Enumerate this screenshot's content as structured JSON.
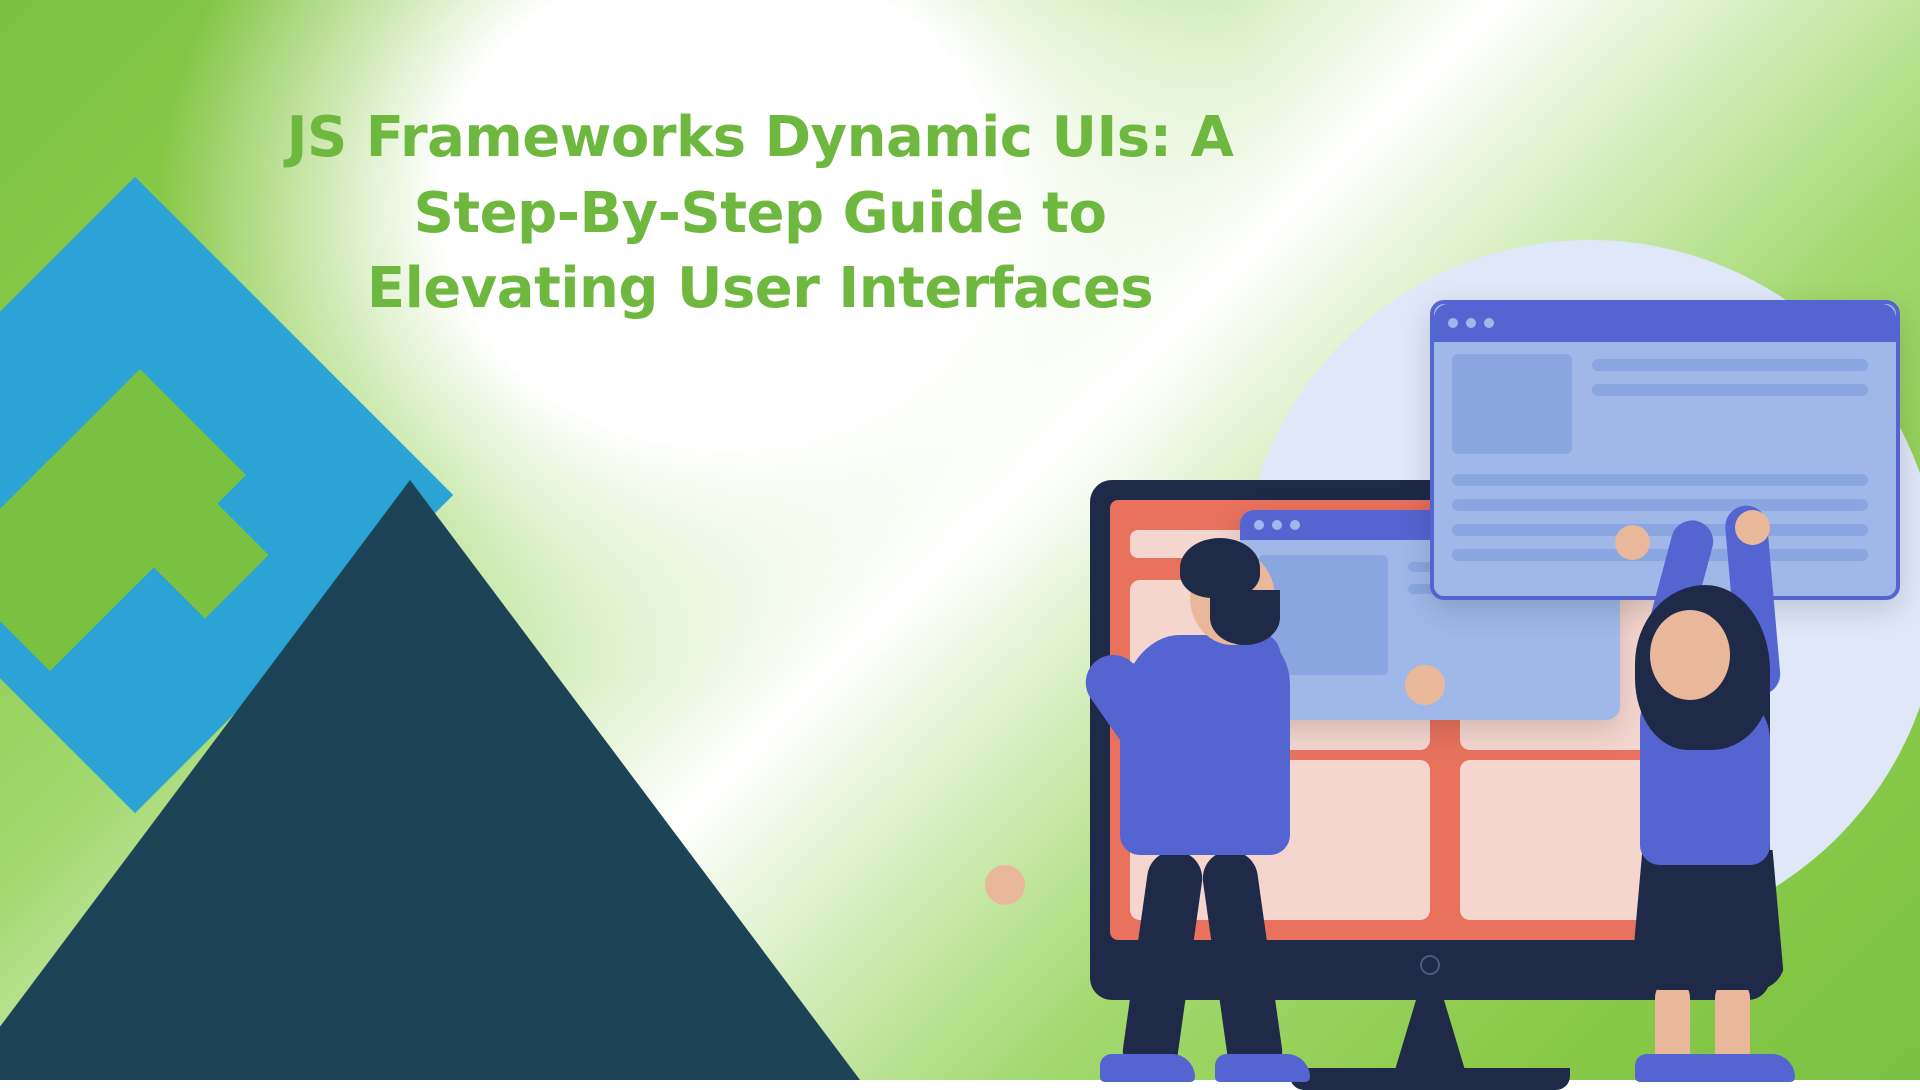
{
  "title": "JS Frameworks Dynamic UIs: A Step-By-Step Guide to Elevating User Interfaces",
  "colors": {
    "title_green": "#6fb83f",
    "bg_green": "#7ac142",
    "triangle_dark": "#1c4456",
    "triangle_blue": "#2ba3d4",
    "accent_purple": "#5465d1",
    "window_body": "#9fb8e8",
    "screen_coral": "#e8725e",
    "monitor_navy": "#1e2a47",
    "skin": "#e9b89b"
  }
}
